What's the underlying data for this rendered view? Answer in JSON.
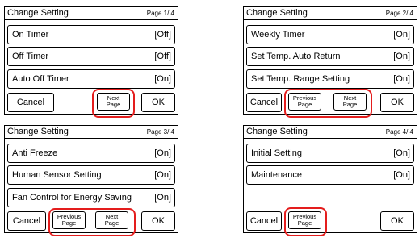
{
  "screens": [
    {
      "title": "Change Setting",
      "page": "Page  1/ 4",
      "rows": [
        {
          "label": "On Timer",
          "value": "[Off]"
        },
        {
          "label": "Off Timer",
          "value": "[Off]"
        },
        {
          "label": "Auto Off Timer",
          "value": "[On]"
        }
      ],
      "buttons": {
        "cancel": "Cancel",
        "next_line1": "Next",
        "next_line2": "Page",
        "ok": "OK"
      }
    },
    {
      "title": "Change Setting",
      "page": "Page  2/ 4",
      "rows": [
        {
          "label": "Weekly Timer",
          "value": "[On]"
        },
        {
          "label": "Set Temp. Auto Return",
          "value": "[On]"
        },
        {
          "label": "Set Temp. Range Setting",
          "value": "[On]"
        }
      ],
      "buttons": {
        "cancel": "Cancel",
        "prev_line1": "Previous",
        "prev_line2": "Page",
        "next_line1": "Next",
        "next_line2": "Page",
        "ok": "OK"
      }
    },
    {
      "title": "Change Setting",
      "page": "Page  3/ 4",
      "rows": [
        {
          "label": "Anti Freeze",
          "value": "[On]"
        },
        {
          "label": "Human Sensor Setting",
          "value": "[On]"
        },
        {
          "label": "Fan Control for Energy Saving",
          "value": "[On]"
        }
      ],
      "buttons": {
        "cancel": "Cancel",
        "prev_line1": "Previous",
        "prev_line2": "Page",
        "next_line1": "Next",
        "next_line2": "Page",
        "ok": "OK"
      }
    },
    {
      "title": "Change Setting",
      "page": "Page  4/ 4",
      "rows": [
        {
          "label": "Initial Setting",
          "value": "[On]"
        },
        {
          "label": "Maintenance",
          "value": "[On]"
        }
      ],
      "buttons": {
        "cancel": "Cancel",
        "prev_line1": "Previous",
        "prev_line2": "Page",
        "ok": "OK"
      }
    }
  ],
  "highlight_color": "#e41d1d"
}
